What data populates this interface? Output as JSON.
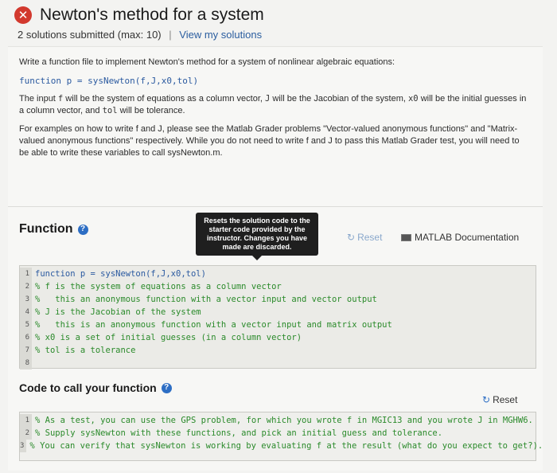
{
  "header": {
    "title": "Newton's method for a system",
    "submissions": "2 solutions submitted (max: 10)",
    "separator": "|",
    "view_link": "View my solutions"
  },
  "description": {
    "intro": "Write a function file to implement Newton's method for a system of nonlinear algebraic equations:",
    "signature": "function p = sysNewton(f,J,x0,tol)",
    "input_pre": "The input ",
    "input_f": "f",
    "input_mid1": " will be the system of equations as a column vector, ",
    "input_J": "J",
    "input_mid2": " will be the Jacobian of the system, ",
    "input_x0": "x0",
    "input_mid3": " will be the initial guesses in a column vector, and ",
    "input_tol": "tol",
    "input_end": " will be tolerance.",
    "examples": "For examples on how to write f and J, please see the Matlab Grader problems \"Vector-valued anonymous functions\" and \"Matrix-valued anonymous functions\" respectively. While you do not need to write f and J to pass this Matlab Grader test, you will need to be able to write these variables to call sysNewton.m."
  },
  "function_section": {
    "title": "Function",
    "help_icon": "question-circle-icon",
    "tooltip_line1": "Resets the solution code to the",
    "tooltip_line2": "starter code provided by the",
    "tooltip_line3": "instructor. Changes you have",
    "tooltip_line4": "made are discarded.",
    "reset_label": "Reset",
    "doc_label": "MATLAB Documentation",
    "code_lines": [
      {
        "n": "1",
        "text": "function p = sysNewton(f,J,x0,tol)",
        "kw": true
      },
      {
        "n": "2",
        "text": "% f is the system of equations as a column vector",
        "kw": false
      },
      {
        "n": "3",
        "text": "%   this an anonymous function with a vector input and vector output",
        "kw": false
      },
      {
        "n": "4",
        "text": "% J is the Jacobian of the system",
        "kw": false
      },
      {
        "n": "5",
        "text": "%   this is an anonymous function with a vector input and matrix output",
        "kw": false
      },
      {
        "n": "6",
        "text": "% x0 is a set of initial guesses (in a column vector)",
        "kw": false
      },
      {
        "n": "7",
        "text": "% tol is a tolerance",
        "kw": false
      },
      {
        "n": "8",
        "text": "",
        "kw": false
      }
    ]
  },
  "call_section": {
    "title": "Code to call your function",
    "reset_label": "Reset",
    "code_lines": [
      {
        "n": "1",
        "text": "% As a test, you can use the GPS problem, for which you wrote f in MGIC13 and you wrote J in MGHW6."
      },
      {
        "n": "2",
        "text": "% Supply sysNewton with these functions, and pick an initial guess and tolerance."
      },
      {
        "n": "3",
        "text": "% You can verify that sysNewton is working by evaluating f at the result (what do you expect to get?)."
      }
    ]
  },
  "colors": {
    "error_badge": "#d2392e",
    "link": "#2a5d9f",
    "comment": "#2a8a2a",
    "keyword": "#2b5aa0"
  }
}
